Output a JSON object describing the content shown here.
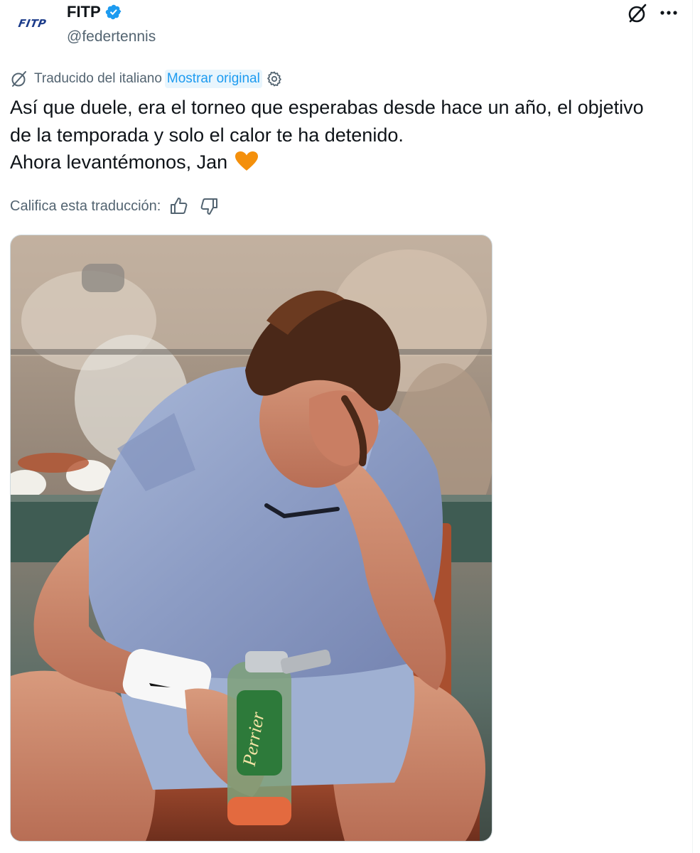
{
  "account": {
    "display_name": "FITP",
    "handle": "@federtennis",
    "avatar_logo": "FITP",
    "verified": true,
    "verified_color": "#1d9bf0"
  },
  "actions": {
    "grok_icon": "grok-icon",
    "more_icon": "more-horizontal-icon"
  },
  "translation": {
    "icon": "translate-icon",
    "translated_label": "Traducido del italiano",
    "show_original_label": "Mostrar original",
    "settings_icon": "gear-icon"
  },
  "tweet": {
    "lines": [
      "Así que duele, era el torneo que esperabas desde hace un año, el objetivo",
      "de la temporada y solo el calor te ha detenido.",
      "Ahora levantémonos, Jan"
    ],
    "emoji": "orange-heart",
    "emoji_color": "#f4900c"
  },
  "rating": {
    "label": "Califica esta traducción:",
    "thumbs_up_icon": "thumbs-up-icon",
    "thumbs_down_icon": "thumbs-down-icon"
  },
  "media": {
    "subject": "tennis-player-head-in-hand-photo",
    "bottle_brand": "Perrier"
  },
  "colors": {
    "text_primary": "#0f1419",
    "text_secondary": "#536471",
    "accent": "#1d9bf0"
  }
}
